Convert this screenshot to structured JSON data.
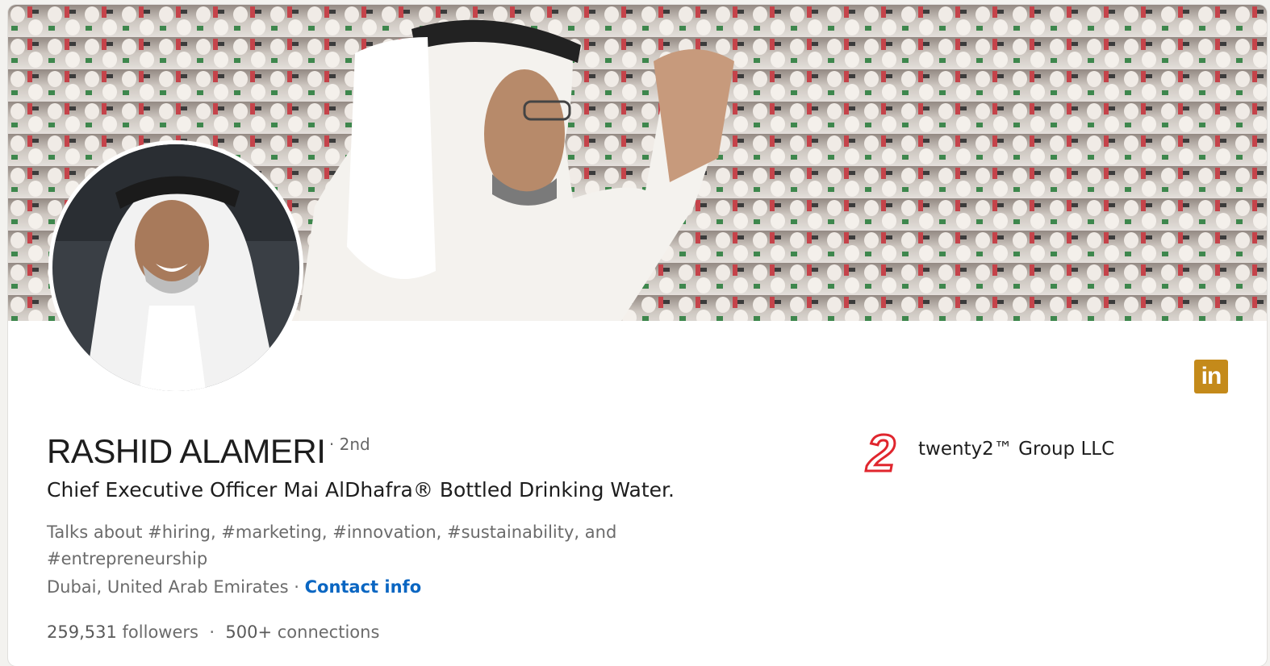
{
  "profile": {
    "name": "RASHID ALAMERI",
    "degree": "· 2nd",
    "headline": "Chief Executive Officer Mai AlDhafra® Bottled Drinking Water.",
    "talks_about": "Talks about #hiring, #marketing, #innovation, #sustainability, and #entrepreneurship",
    "location": "Dubai, United Arab Emirates",
    "separator": " · ",
    "contact_info": "Contact info",
    "followers_count": "259,531",
    "followers_label": "followers",
    "connections_count": "500+",
    "connections_label": "connections"
  },
  "company": {
    "logo_text": "2",
    "name": "twenty2™ Group LLC"
  },
  "badge": {
    "label": "in"
  },
  "icons": {
    "linkedin": "linkedin-icon",
    "company_logo": "twenty2-logo-icon"
  },
  "colors": {
    "link": "#0a66c2",
    "linkedin_badge": "#c48a1a",
    "company_logo": "#e0262e"
  }
}
